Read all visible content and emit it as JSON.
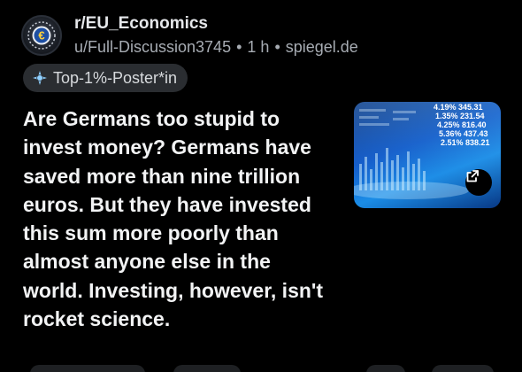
{
  "post": {
    "subreddit": "r/EU_Economics",
    "author": "u/Full-Discussion3745",
    "separator": "•",
    "age": "1 h",
    "domain": "spiegel.de",
    "flair": "Top-1%-Poster*in",
    "title": "Are Germans too stupid to invest money? Germans have saved more than nine trillion euros. But they have invested this sum more poorly than almost anyone else in the world. Investing, however, isn't rocket science."
  },
  "icons": {
    "avatar": "euro-coin-icon",
    "flair": "swirl-badge-icon",
    "external": "open-external-icon"
  },
  "thumbnail": {
    "ticker_lines": [
      "4.19% 345.31",
      "1.35% 231.54",
      "4.25% 816.40",
      "5.36% 437.43",
      "2.51% 838.21"
    ]
  },
  "colors": {
    "background": "#000000",
    "flair_bg": "#2a2d31",
    "muted_text": "#a7acb3",
    "title_text": "#f2f3f4"
  }
}
